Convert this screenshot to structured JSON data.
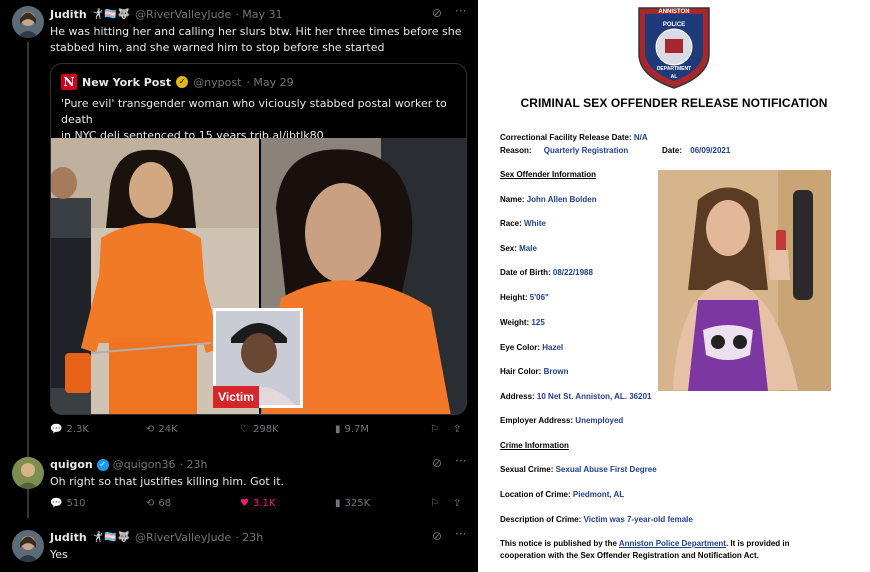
{
  "tweets": [
    {
      "name": "Judith",
      "emojis": "🤺🏳️‍⚧️🐺",
      "handle": "@RiverValleyJude",
      "date": "· May 31",
      "text_line1": "He was hitting her and calling her slurs btw. Hit her three times before she",
      "text_line2": "stabbed him, and she warned him to stop before she started",
      "avatar": "avatar-photo",
      "stats": {
        "replies": "2.3K",
        "reposts": "24K",
        "likes": "298K",
        "views": "9.7M"
      }
    },
    {
      "name": "quigon",
      "handle": "@quigon36",
      "date": "· 23h",
      "text": "Oh right so that justifies killing him. Got it.",
      "avatar": "avatar-photo",
      "stats": {
        "replies": "510",
        "reposts": "68",
        "likes": "3.1K",
        "views": "325K"
      }
    },
    {
      "name": "Judith",
      "emojis": "🤺🏳️‍⚧️🐺",
      "handle": "@RiverValleyJude",
      "date": "· 23h",
      "text": "Yes"
    }
  ],
  "quote": {
    "name": "New York Post",
    "handle": "@nypost",
    "date": "· May 29",
    "text_line1": "'Pure evil' transgender woman who viciously stabbed postal worker to death",
    "text_line2": "in NYC deli sentenced to 15 years trib.al/jbtlk80",
    "logo": "N",
    "victim_label": "Victim"
  },
  "document": {
    "badge_top": "ANNISTON",
    "badge_mid": "POLICE",
    "badge_ring": "DEPARTMENT",
    "badge_state": "AL",
    "title": "CRIMINAL SEX OFFENDER RELEASE NOTIFICATION",
    "release_label": "Correctional Facility Release Date:",
    "release_value": "N/A",
    "reason_label": "Reason:",
    "reason_value": "Quarterly Registration",
    "date_label": "Date:",
    "date_value": "06/09/2021",
    "section_offender": "Sex Offender Information",
    "name_label": "Name:",
    "name_value": "John Allen Bolden",
    "race_label": "Race:",
    "race_value": "White",
    "sex_label": "Sex:",
    "sex_value": "Male",
    "dob_label": "Date of Birth:",
    "dob_value": "08/22/1988",
    "height_label": "Height:",
    "height_value": "5'06\"",
    "weight_label": "Weight:",
    "weight_value": "125",
    "eye_label": "Eye Color:",
    "eye_value": "Hazel",
    "hair_label": "Hair Color:",
    "hair_value": "Brown",
    "address_label": "Address:",
    "address_value": "10 Net St. Anniston, AL. 36201",
    "employer_label": "Employer Address:",
    "employer_value": "Unemployed",
    "section_crime": "Crime Information",
    "crime_label": "Sexual Crime:",
    "crime_value": "Sexual Abuse First Degree",
    "location_label": "Location of Crime:",
    "location_value": "Piedmont, AL",
    "desc_label": "Description of Crime:",
    "desc_value": "Victim was 7-year-old female",
    "notice_1a": "This notice is published by the ",
    "notice_1b": "Anniston Police Department",
    "notice_1c": ". It is provided in",
    "notice_2": "cooperation with the Sex Offender Registration and Notification Act."
  },
  "colors": {
    "like_pink": "#f91880",
    "verified_blue": "#1d9bf0",
    "verified_gold": "#e2b719",
    "doc_blue": "#1f3f8f",
    "victim_red": "#d7262a"
  }
}
